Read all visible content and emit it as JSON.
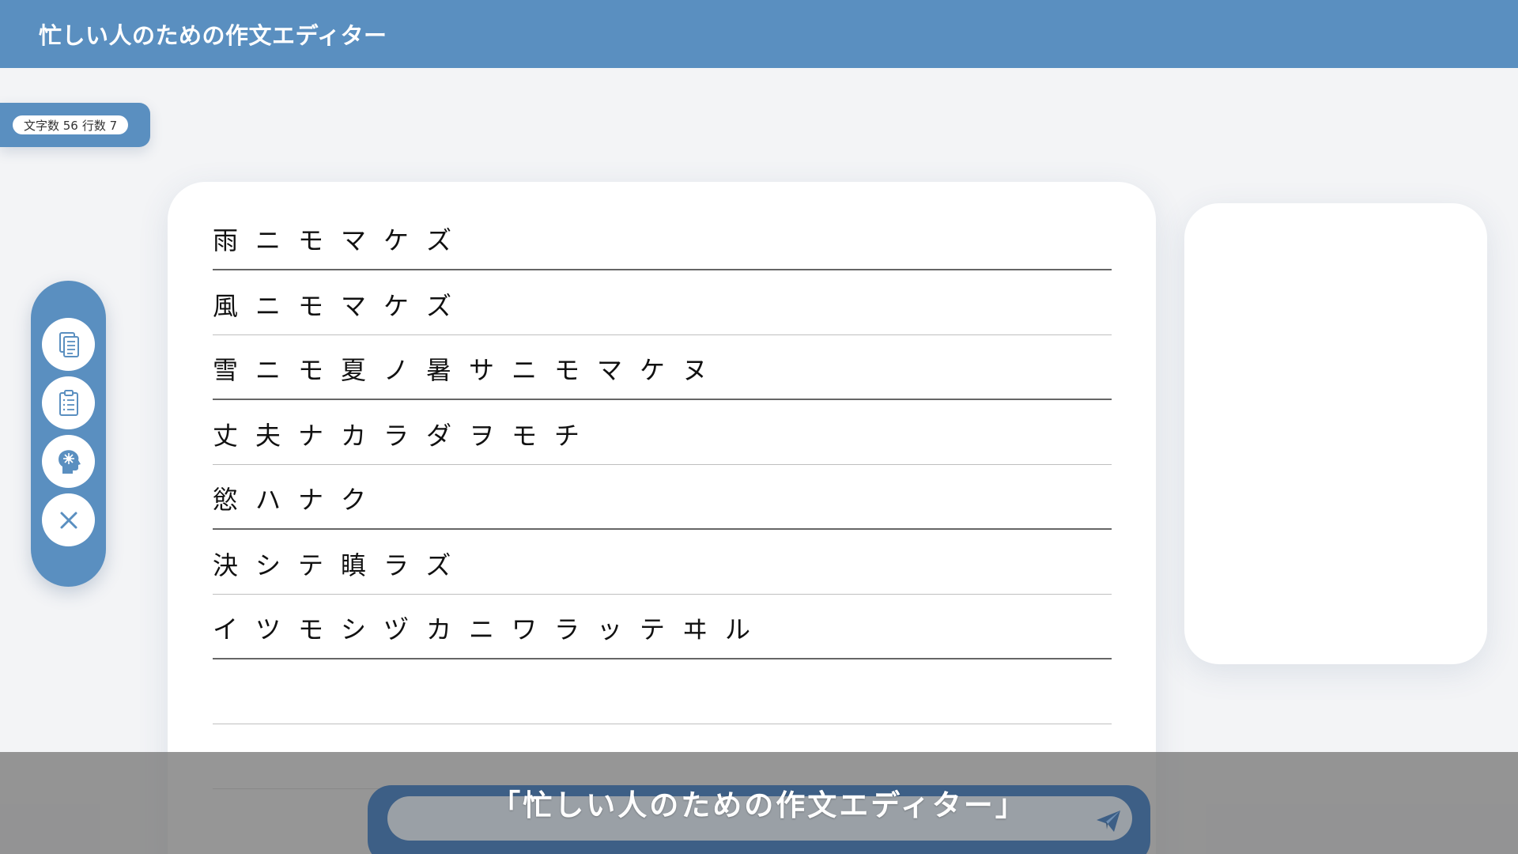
{
  "app": {
    "title": "忙しい人のための作文エディター"
  },
  "counter": {
    "char_count_label": "文字数 56",
    "line_count_label": "行数 7"
  },
  "editor": {
    "lines": [
      "雨ニモマケズ",
      "風ニモマケズ",
      "雪ニモ夏ノ暑サニモマケヌ",
      "丈夫ナカラダヲモチ",
      "慾ハナク",
      "決シテ瞋ラズ",
      "イツモシヅカニワラッテヰル",
      ""
    ]
  },
  "toolbar": {
    "icons": [
      "copy-icon",
      "clipboard-icon",
      "brain-icon",
      "close-icon"
    ],
    "accent": "#5a8fc0",
    "icon_color": "#5a8fc0"
  },
  "caption": {
    "text": "「忙しい人のための作文エディター」"
  },
  "input": {
    "value": "",
    "placeholder": ""
  },
  "colors": {
    "header": "#5a8fc0",
    "background": "#f3f4f6",
    "input_bar": "#3d5f86"
  }
}
